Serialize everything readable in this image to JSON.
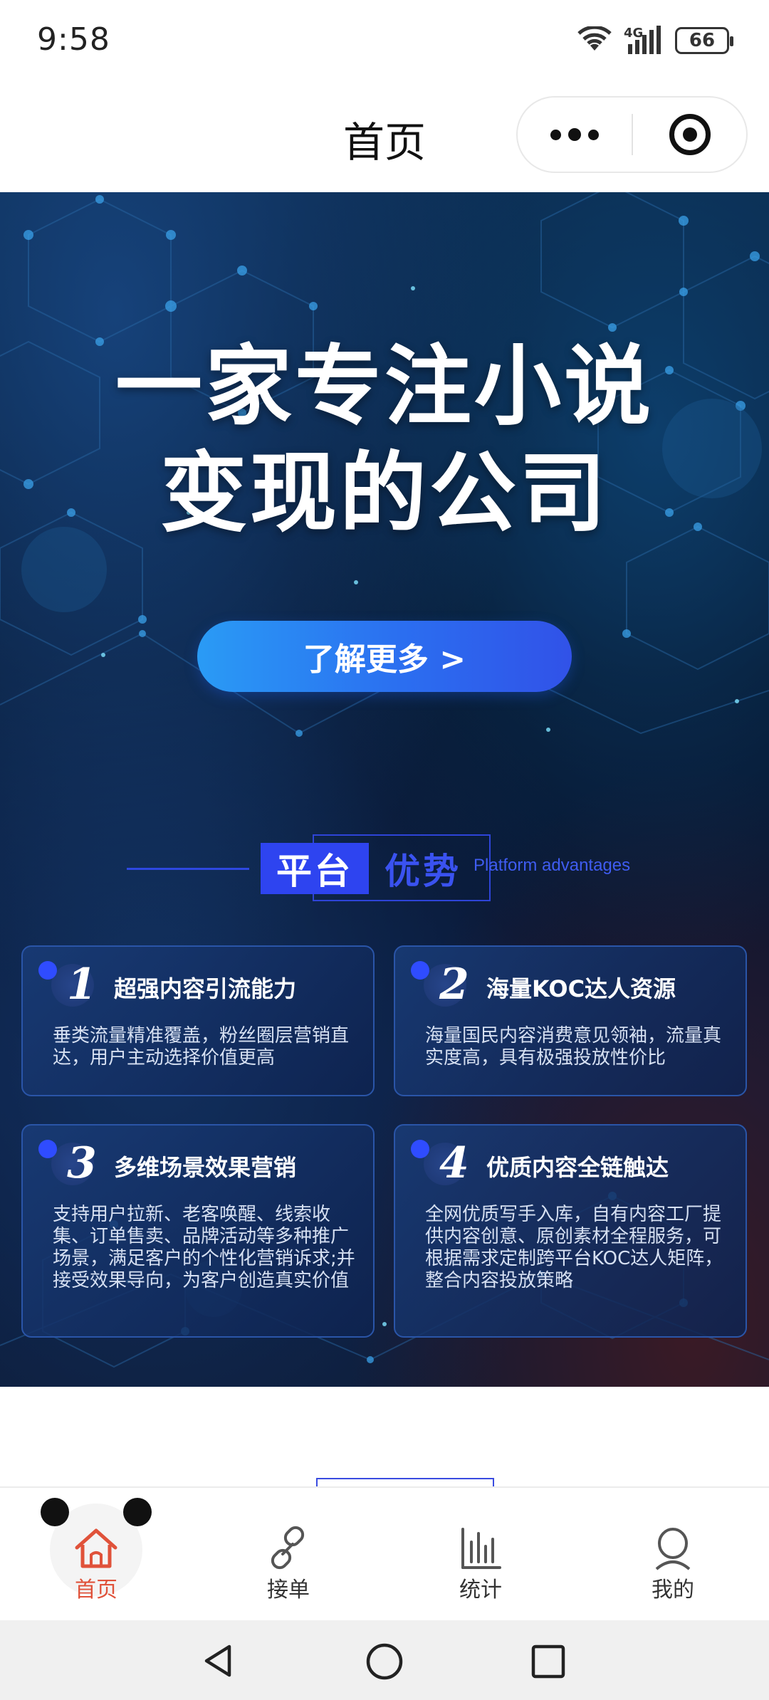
{
  "status_bar": {
    "time": "9:58",
    "network": "4G",
    "battery": "66",
    "icons": [
      "wifi-icon",
      "cellular-signal-icon",
      "battery-icon"
    ]
  },
  "nav": {
    "title": "首页",
    "more_icon": "more-dots-icon",
    "close_icon": "target-close-icon"
  },
  "hero": {
    "headline_line1": "一家专注小说",
    "headline_line2": "变现的公司",
    "more_button": "了解更多 >"
  },
  "section": {
    "title_primary": "平台",
    "title_secondary": "优势",
    "title_en": "Platform advantages"
  },
  "cards": [
    {
      "number": "1",
      "title": "超强内容引流能力",
      "desc": "垂类流量精准覆盖，粉丝圈层营销直达，用户主动选择价值更高"
    },
    {
      "number": "2",
      "title": "海量KOC达人资源",
      "desc": "海量国民内容消费意见领袖，流量真实度高，具有极强投放性价比"
    },
    {
      "number": "3",
      "title": "多维场景效果营销",
      "desc": "支持用户拉新、老客唤醒、线索收集、订单售卖、品牌活动等多种推广场景，满足客户的个性化营销诉求;并接受效果导向，为客户创造真实价值"
    },
    {
      "number": "4",
      "title": "优质内容全链触达",
      "desc": "全网优质写手入库，自有内容工厂提供内容创意、原创素材全程服务，可根据需求定制跨平台KOC达人矩阵，整合内容投放策略"
    }
  ],
  "tabs": [
    {
      "label": "首页",
      "icon": "home-icon",
      "active": true
    },
    {
      "label": "接单",
      "icon": "link-icon",
      "active": false
    },
    {
      "label": "统计",
      "icon": "bar-chart-icon",
      "active": false
    },
    {
      "label": "我的",
      "icon": "user-icon",
      "active": false
    }
  ],
  "colors": {
    "accent_blue": "#2e44f0",
    "active_tab": "#e0523a",
    "hero_bg": "#061430"
  }
}
